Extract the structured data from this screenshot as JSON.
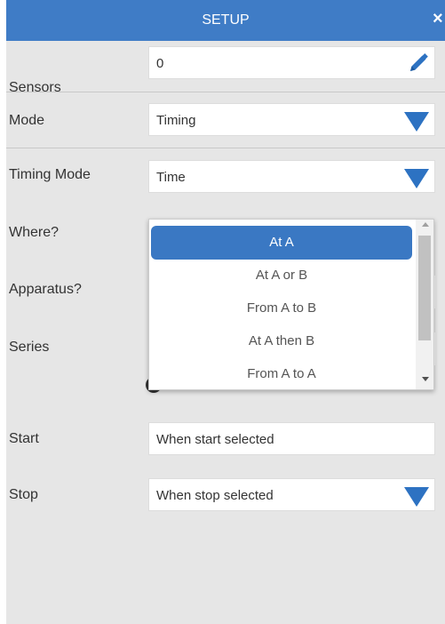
{
  "header": {
    "title": "SETUP",
    "close_glyph": "×"
  },
  "rows": {
    "sensors": {
      "label": "Sensors",
      "value": "0",
      "icon": "pencil-icon"
    },
    "mode": {
      "label": "Mode",
      "value": "Timing",
      "icon": "triangle-down-icon"
    },
    "timing_mode": {
      "label": "Timing Mode",
      "value": "Time",
      "icon": "triangle-down-icon"
    },
    "where": {
      "label": "Where?"
    },
    "apparatus": {
      "label": "Apparatus?"
    },
    "series": {
      "label": "Series"
    },
    "start": {
      "label": "Start",
      "value": "When start selected"
    },
    "stop": {
      "label": "Stop",
      "value": "When stop selected",
      "icon": "triangle-down-icon"
    }
  },
  "dropdown": {
    "selected": "At A",
    "options": [
      "At A",
      "At A or B",
      "From A to B",
      "At A then B",
      "From A to A"
    ]
  },
  "colors": {
    "header_bg": "#3f7cc6",
    "panel_bg": "#e6e6e6",
    "accent": "#2d72c2",
    "selected_option_bg": "#3a78c3"
  }
}
